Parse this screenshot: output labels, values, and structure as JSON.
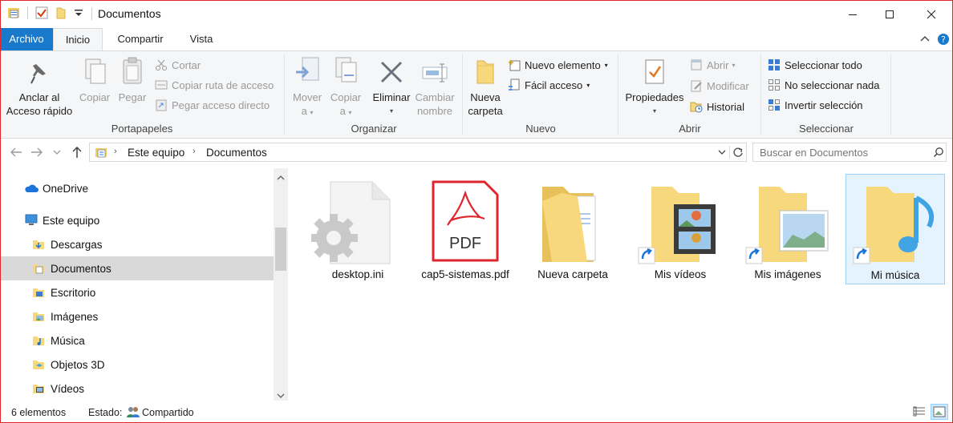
{
  "window": {
    "title": "Documentos",
    "minimize_glyph": "—",
    "maximize_glyph": "☐",
    "close_glyph": "✕"
  },
  "tabs": {
    "file": "Archivo",
    "home": "Inicio",
    "share": "Compartir",
    "view": "Vista"
  },
  "ribbon": {
    "clipboard": {
      "label": "Portapapeles",
      "pin_l1": "Anclar al",
      "pin_l2": "Acceso rápido",
      "copy": "Copiar",
      "paste": "Pegar",
      "cut": "Cortar",
      "copy_path": "Copiar ruta de acceso",
      "paste_shortcut": "Pegar acceso directo"
    },
    "organize": {
      "label": "Organizar",
      "move_l1": "Mover",
      "move_l2": "a",
      "copy_l1": "Copiar",
      "copy_l2": "a",
      "delete": "Eliminar",
      "rename_l1": "Cambiar",
      "rename_l2": "nombre"
    },
    "new": {
      "label": "Nuevo",
      "folder_l1": "Nueva",
      "folder_l2": "carpeta",
      "new_item": "Nuevo elemento",
      "easy_access": "Fácil acceso"
    },
    "open": {
      "label": "Abrir",
      "properties": "Propiedades",
      "open": "Abrir",
      "edit": "Modificar",
      "history": "Historial"
    },
    "select": {
      "label": "Seleccionar",
      "all": "Seleccionar todo",
      "none": "No seleccionar nada",
      "invert": "Invertir selección"
    }
  },
  "address": {
    "crumb1": "Este equipo",
    "crumb2": "Documentos",
    "search_placeholder": "Buscar en Documentos"
  },
  "nav": {
    "onedrive": "OneDrive",
    "this_pc": "Este equipo",
    "downloads": "Descargas",
    "documents": "Documentos",
    "desktop": "Escritorio",
    "pictures": "Imágenes",
    "music": "Música",
    "objects3d": "Objetos 3D",
    "videos": "Vídeos"
  },
  "files": [
    {
      "name": "desktop.ini",
      "icon": "settings-file-icon"
    },
    {
      "name": "cap5-sistemas.pdf",
      "icon": "pdf-icon",
      "badge": "PDF"
    },
    {
      "name": "Nueva carpeta",
      "icon": "folder-icon"
    },
    {
      "name": "Mis vídeos",
      "icon": "video-folder-shortcut-icon"
    },
    {
      "name": "Mis imágenes",
      "icon": "pictures-folder-shortcut-icon"
    },
    {
      "name": "Mi música",
      "icon": "music-folder-shortcut-icon"
    }
  ],
  "status": {
    "count": "6 elementos",
    "state_label": "Estado:",
    "state_value": "Compartido"
  },
  "colors": {
    "accent": "#1979ca",
    "selection": "#e5f3ff",
    "folder": "#f7d87c",
    "pdf_red": "#e0262d"
  }
}
